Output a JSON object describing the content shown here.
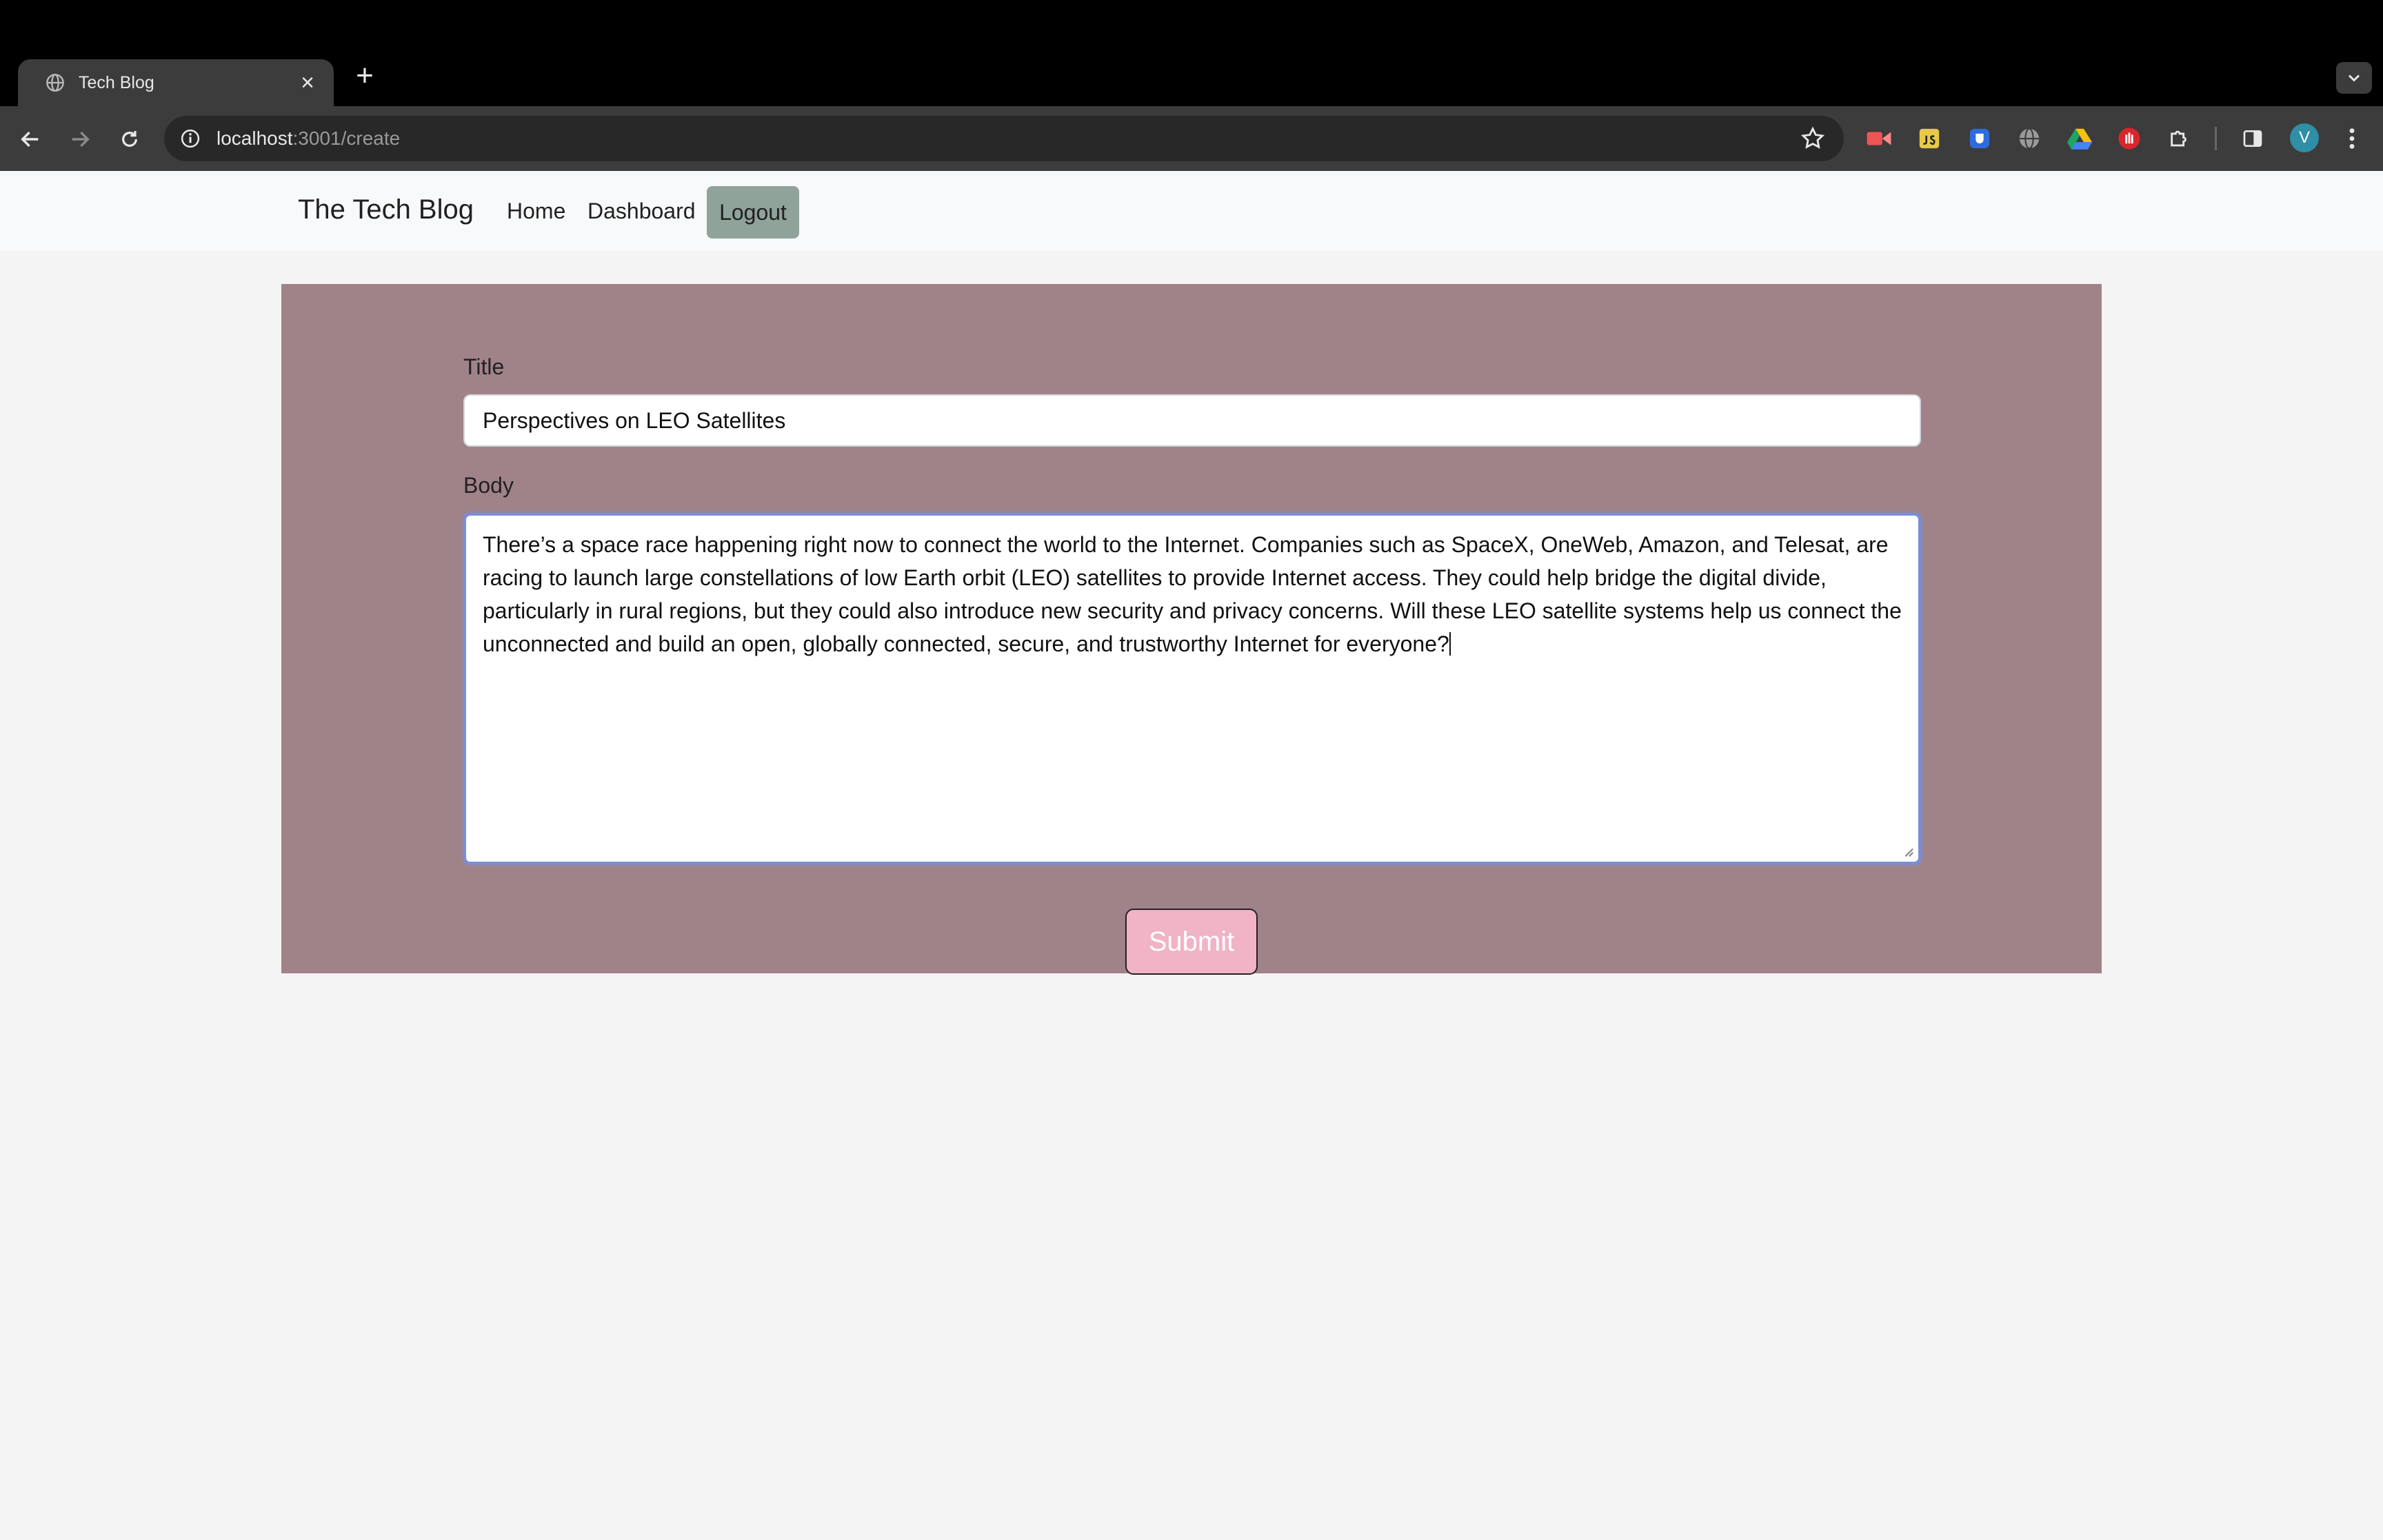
{
  "browser": {
    "tab_title": "Tech Blog",
    "tab_close": "×",
    "new_tab": "+",
    "url_host": "localhost",
    "url_rest": ":3001/create",
    "avatar_letter": "V"
  },
  "navbar": {
    "brand": "The Tech Blog",
    "links": [
      "Home",
      "Dashboard"
    ],
    "logout": "Logout",
    "logout_color": "#8fa39b"
  },
  "form": {
    "title_label": "Title",
    "title_value": "Perspectives on LEO Satellites",
    "body_label": "Body",
    "body_value": "There’s a space race happening right now to connect the world to the Internet. Companies such as SpaceX, OneWeb, Amazon, and Telesat, are racing to launch large constellations of low Earth orbit (LEO) satellites to provide Internet access. They could help bridge the digital divide, particularly in rural regions, but they could also introduce new security and privacy concerns. Will these LEO satellite systems help us connect the unconnected and build an open, globally connected, secure, and trustworthy Internet for everyone?",
    "submit": "Submit",
    "panel_color": "#a08388",
    "submit_color": "#f1b3c6"
  }
}
